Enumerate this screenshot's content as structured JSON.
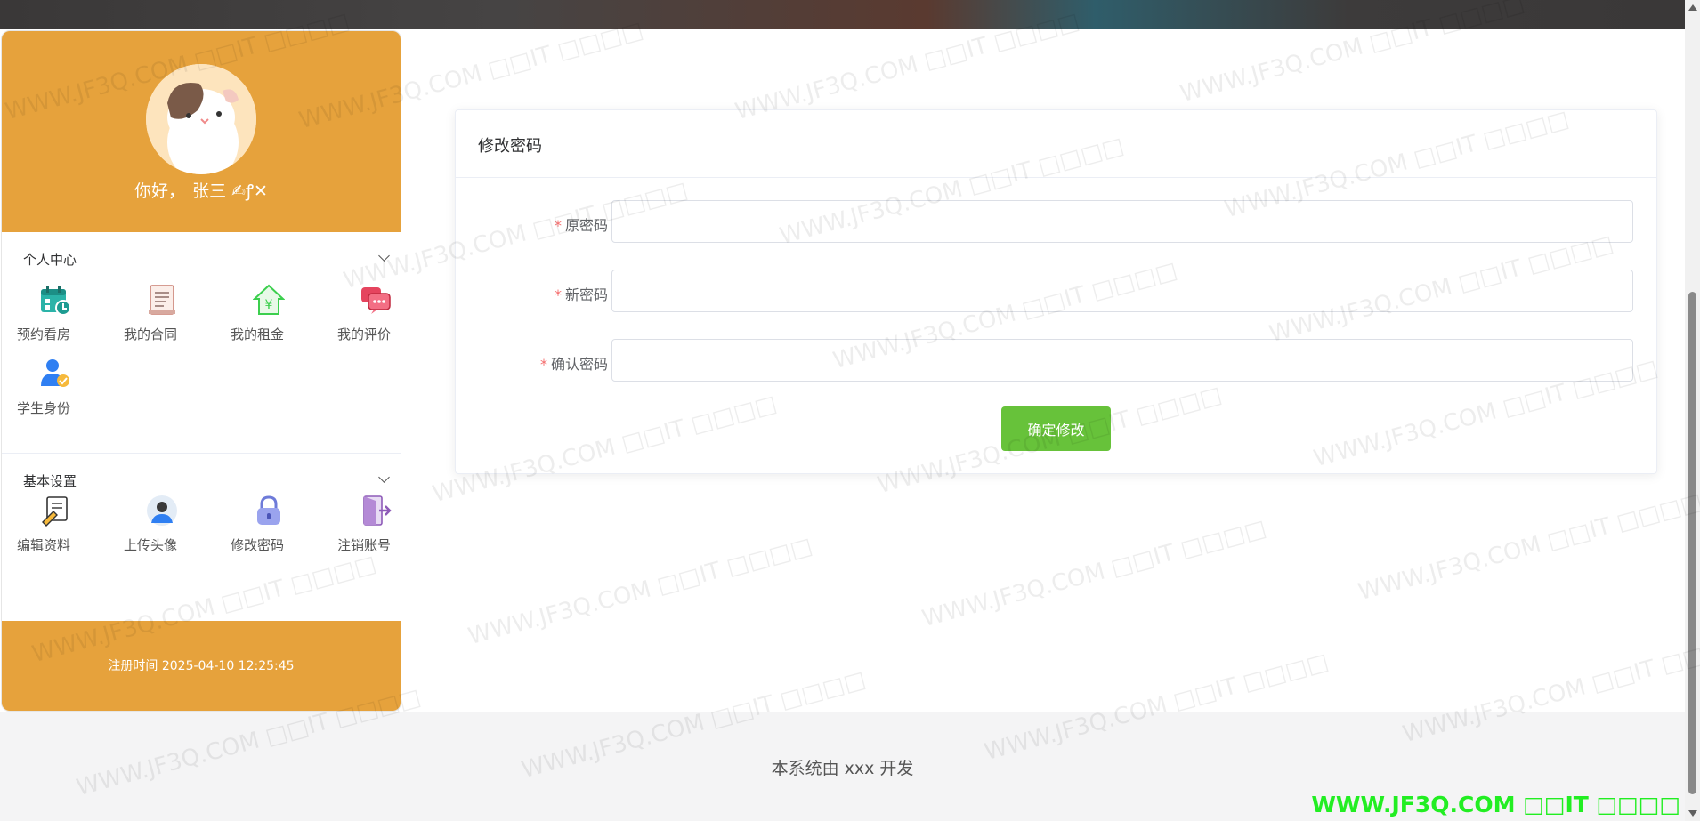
{
  "sidebar": {
    "greeting_prefix": "你好，",
    "user_name": "张三 ✍ꝭ✕",
    "personal_center": {
      "title": "个人中心",
      "items": [
        {
          "label": "预约看房",
          "icon": "calendar-clock-icon"
        },
        {
          "label": "我的合同",
          "icon": "contract-document-icon"
        },
        {
          "label": "我的租金",
          "icon": "rent-house-yuan-icon"
        },
        {
          "label": "我的评价",
          "icon": "chat-bubble-icon"
        },
        {
          "label": "学生身份",
          "icon": "student-badge-icon"
        }
      ]
    },
    "basic_settings": {
      "title": "基本设置",
      "items": [
        {
          "label": "编辑资料",
          "icon": "edit-document-icon"
        },
        {
          "label": "上传头像",
          "icon": "avatar-upload-icon"
        },
        {
          "label": "修改密码",
          "icon": "lock-icon"
        },
        {
          "label": "注销账号",
          "icon": "logout-door-icon"
        }
      ]
    },
    "register_time": "注册时间 2025-04-10 12:25:45"
  },
  "form": {
    "title": "修改密码",
    "fields": [
      {
        "label": "原密码",
        "value": "",
        "placeholder": ""
      },
      {
        "label": "新密码",
        "value": "",
        "placeholder": ""
      },
      {
        "label": "确认密码",
        "value": "",
        "placeholder": ""
      }
    ],
    "submit_label": "确定修改"
  },
  "footer": {
    "text": "本系统由 xxx 开发"
  },
  "watermark": {
    "text": "WWW.JF3Q.COM □□IT □□□□",
    "corner_text": "WWW.JF3Q.COM □□IT □□□□"
  },
  "colors": {
    "accent_orange": "#e6a23c",
    "button_green": "#67c23a",
    "required_red": "#f56c6c"
  }
}
